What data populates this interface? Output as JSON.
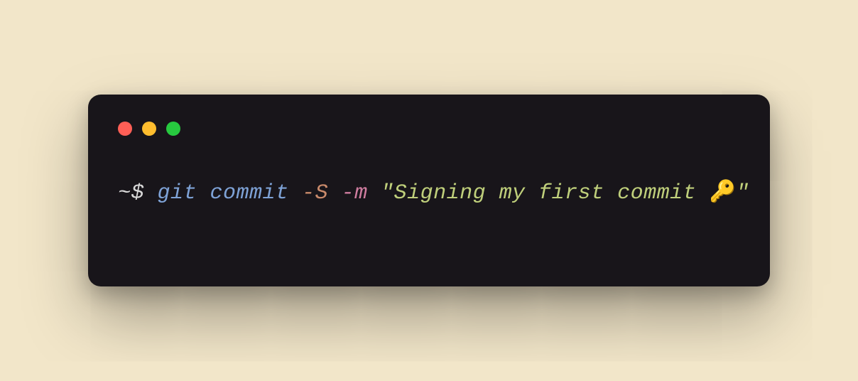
{
  "terminal": {
    "prompt": "~$ ",
    "command": "git commit ",
    "flag_s": "-S ",
    "flag_m": "-m ",
    "string_open": "\"",
    "message": "Signing my first commit ",
    "emoji": "🔑",
    "string_close": "\""
  },
  "traffic_lights": {
    "red": "#ff5f56",
    "yellow": "#ffbd2e",
    "green": "#27c93f"
  }
}
